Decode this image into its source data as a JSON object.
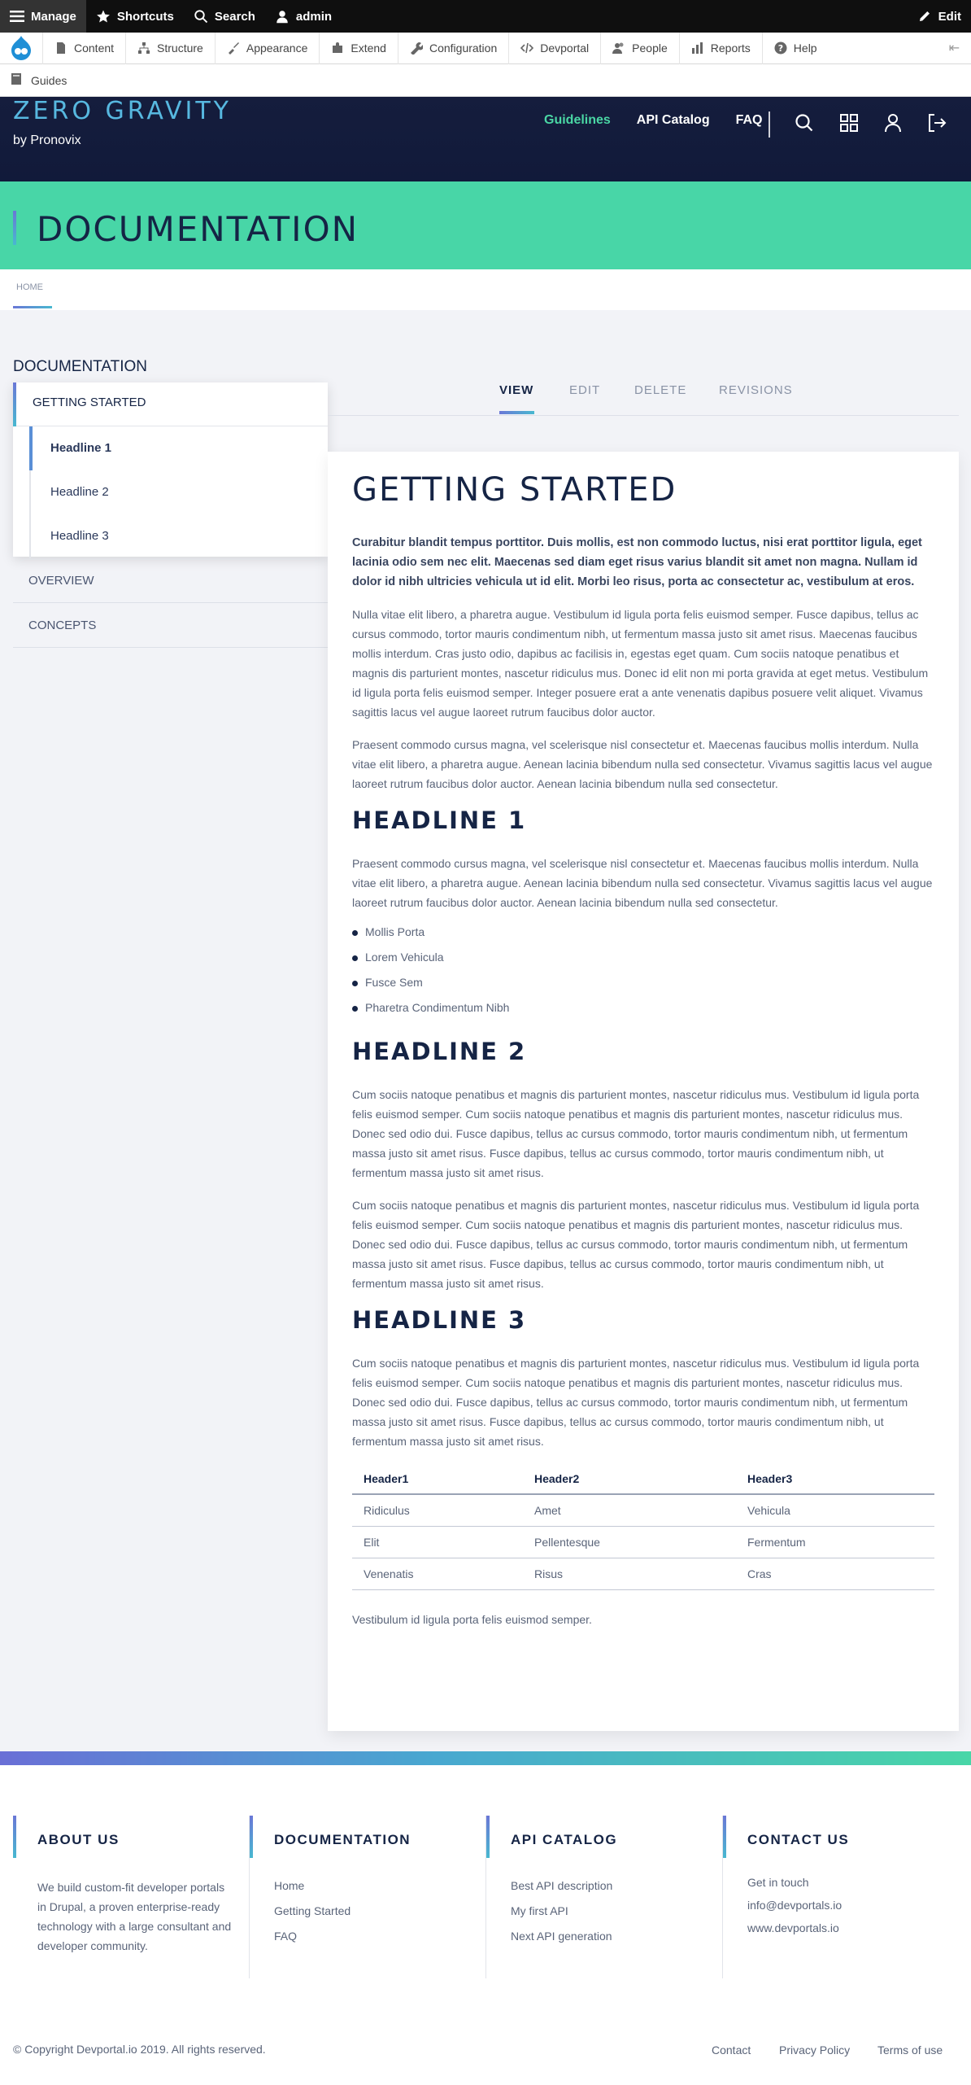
{
  "toolbar": {
    "manage": "Manage",
    "shortcuts": "Shortcuts",
    "search": "Search",
    "user": "admin",
    "edit": "Edit"
  },
  "tray": {
    "items": [
      "Content",
      "Structure",
      "Appearance",
      "Extend",
      "Configuration",
      "Devportal",
      "People",
      "Reports",
      "Help"
    ],
    "guides": "Guides"
  },
  "header": {
    "brand": "ZERO GRAVITY",
    "brand_sub": "by Pronovix",
    "nav": [
      "Guidelines",
      "API Catalog",
      "FAQ"
    ]
  },
  "hero": {
    "title": "DOCUMENTATION"
  },
  "breadcrumb": {
    "home": "HOME"
  },
  "sidebar": {
    "title": "DOCUMENTATION",
    "active": "GETTING STARTED",
    "subitems": [
      "Headline 1",
      "Headline 2",
      "Headline 3"
    ],
    "links": [
      "OVERVIEW",
      "CONCEPTS"
    ]
  },
  "tabs": [
    "VIEW",
    "EDIT",
    "DELETE",
    "REVISIONS"
  ],
  "article": {
    "title": "GETTING STARTED",
    "lead": "Curabitur blandit tempus porttitor. Duis mollis, est non commodo luctus, nisi erat porttitor ligula, eget lacinia odio sem nec elit. Maecenas sed diam eget risus varius blandit sit amet non magna. Nullam id dolor id nibh ultricies vehicula ut id elit. Morbi leo risus, porta ac consectetur ac, vestibulum at eros.",
    "p1": "Nulla vitae elit libero, a pharetra augue. Vestibulum id ligula porta felis euismod semper. Fusce dapibus, tellus ac cursus commodo, tortor mauris condimentum nibh, ut fermentum massa justo sit amet risus. Maecenas faucibus mollis interdum. Cras justo odio, dapibus ac facilisis in, egestas eget quam. Cum sociis natoque penatibus et magnis dis parturient montes, nascetur ridiculus mus. Donec id elit non mi porta gravida at eget metus. Vestibulum id ligula porta felis euismod semper. Integer posuere erat a ante venenatis dapibus posuere velit aliquet. Vivamus sagittis lacus vel augue laoreet rutrum faucibus dolor auctor.",
    "p2": "Praesent commodo cursus magna, vel scelerisque nisl consectetur et. Maecenas faucibus mollis interdum. Nulla vitae elit libero, a pharetra augue. Aenean lacinia bibendum nulla sed consectetur. Vivamus sagittis lacus vel augue laoreet rutrum faucibus dolor auctor. Aenean lacinia bibendum nulla sed consectetur.",
    "h1": "HEADLINE 1",
    "h1_p": "Praesent commodo cursus magna, vel scelerisque nisl consectetur et. Maecenas faucibus mollis interdum. Nulla vitae elit libero, a pharetra augue. Aenean lacinia bibendum nulla sed consectetur. Vivamus sagittis lacus vel augue laoreet rutrum faucibus dolor auctor. Aenean lacinia bibendum nulla sed consectetur.",
    "bullets": [
      "Mollis Porta",
      "Lorem Vehicula",
      "Fusce Sem",
      "Pharetra Condimentum Nibh"
    ],
    "h2": "HEADLINE 2",
    "h2_p1": "Cum sociis natoque penatibus et magnis dis parturient montes, nascetur ridiculus mus. Vestibulum id ligula porta felis euismod semper. Cum sociis natoque penatibus et magnis dis parturient montes, nascetur ridiculus mus. Donec sed odio dui. Fusce dapibus, tellus ac cursus commodo, tortor mauris condimentum nibh, ut fermentum massa justo sit amet risus. Fusce dapibus, tellus ac cursus commodo, tortor mauris condimentum nibh, ut fermentum massa justo sit amet risus.",
    "h2_p2": "Cum sociis natoque penatibus et magnis dis parturient montes, nascetur ridiculus mus. Vestibulum id ligula porta felis euismod semper. Cum sociis natoque penatibus et magnis dis parturient montes, nascetur ridiculus mus. Donec sed odio dui. Fusce dapibus, tellus ac cursus commodo, tortor mauris condimentum nibh, ut fermentum massa justo sit amet risus. Fusce dapibus, tellus ac cursus commodo, tortor mauris condimentum nibh, ut fermentum massa justo sit amet risus.",
    "h3": "HEADLINE 3",
    "h3_p": "Cum sociis natoque penatibus et magnis dis parturient montes, nascetur ridiculus mus. Vestibulum id ligula porta felis euismod semper. Cum sociis natoque penatibus et magnis dis parturient montes, nascetur ridiculus mus. Donec sed odio dui. Fusce dapibus, tellus ac cursus commodo, tortor mauris condimentum nibh, ut fermentum massa justo sit amet risus. Fusce dapibus, tellus ac cursus commodo, tortor mauris condimentum nibh, ut fermentum massa justo sit amet risus.",
    "table": {
      "headers": [
        "Header1",
        "Header2",
        "Header3"
      ],
      "rows": [
        [
          "Ridiculus",
          "Amet",
          "Vehicula"
        ],
        [
          "Elit",
          "Pellentesque",
          "Fermentum"
        ],
        [
          "Venenatis",
          "Risus",
          "Cras"
        ]
      ]
    },
    "closing": "Vestibulum id ligula porta felis euismod semper."
  },
  "footer": {
    "about_title": "ABOUT US",
    "about_text": "We build custom-fit developer portals in Drupal, a proven enterprise-ready technology with a large consultant and developer community.",
    "doc_title": "DOCUMENTATION",
    "doc_links": [
      "Home",
      "Getting Started",
      "FAQ"
    ],
    "api_title": "API CATALOG",
    "api_links": [
      "Best API description",
      "My first API",
      "Next API generation"
    ],
    "contact_title": "CONTACT US",
    "contact_links": [
      "Get in touch",
      "info@devportals.io",
      "www.devportals.io"
    ],
    "copyright": "© Copyright Devportal.io 2019. All rights reserved.",
    "legal": [
      "Contact",
      "Privacy Policy",
      "Terms of use"
    ]
  },
  "colors": {
    "accent_green": "#48d6a7",
    "navy": "#152445",
    "link_active": "#4ad6a4"
  }
}
